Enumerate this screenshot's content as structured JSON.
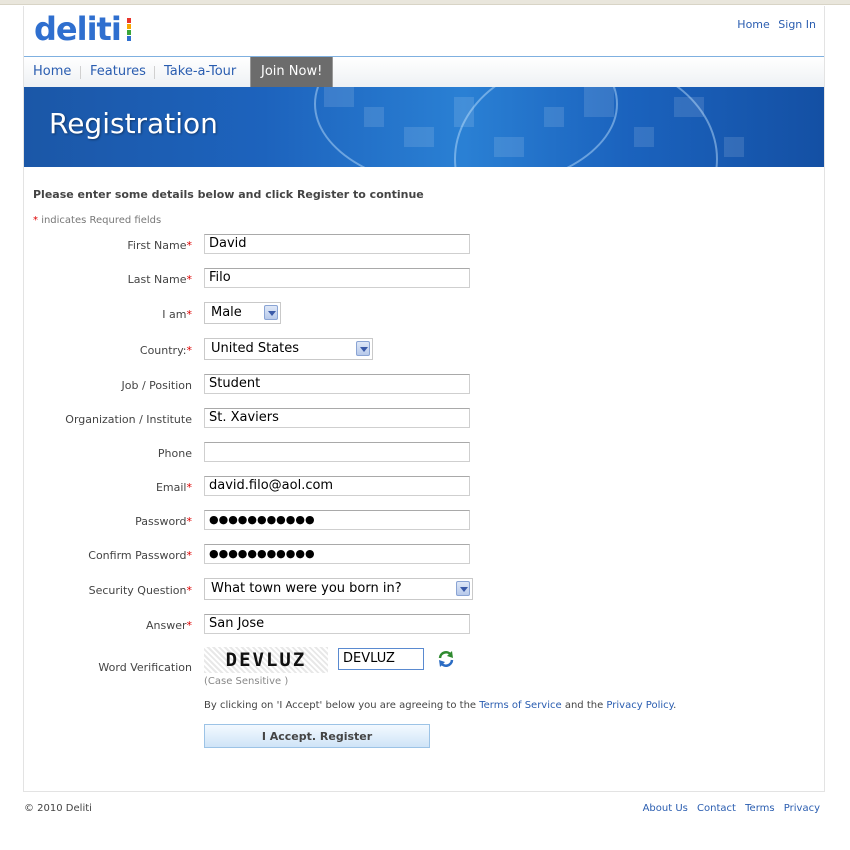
{
  "brand": {
    "logo_text": "deliti",
    "logo_colors": [
      "#e8352b",
      "#f7a600",
      "#3aa63a",
      "#2f6fcf"
    ]
  },
  "top_links": {
    "home": "Home",
    "sign_in": "Sign In"
  },
  "nav": {
    "home": "Home",
    "features": "Features",
    "tour": "Take-a-Tour",
    "join": "Join Now!"
  },
  "banner": {
    "title": "Registration"
  },
  "form": {
    "intro": "Please enter some details below and click Register to continue",
    "required_note_star": "*",
    "required_note": "indicates Requred fields",
    "first_name": {
      "label": "First Name",
      "value": "David"
    },
    "last_name": {
      "label": "Last Name",
      "value": "Filo"
    },
    "gender": {
      "label": "I am",
      "value": "Male"
    },
    "country": {
      "label": "Country:",
      "value": "United States"
    },
    "job": {
      "label": "Job / Position",
      "value": "Student"
    },
    "organization": {
      "label": "Organization / Institute",
      "value": "St. Xaviers"
    },
    "phone": {
      "label": "Phone",
      "value": ""
    },
    "email": {
      "label": "Email",
      "value": "david.filo@aol.com"
    },
    "password": {
      "label": "Password",
      "value": "●●●●●●●●●●●"
    },
    "confirm_password": {
      "label": "Confirm Password",
      "value": "●●●●●●●●●●●"
    },
    "security_question": {
      "label": "Security Question",
      "value": "What town were you born in?"
    },
    "answer": {
      "label": "Answer",
      "value": "San Jose"
    },
    "word_verification": {
      "label": "Word Verification",
      "captcha_text": "DEVLUZ",
      "value": "DEVLUZ",
      "case_note": "(Case Sensitive )"
    },
    "agreement": {
      "prefix": "By clicking on 'I Accept' below you are agreeing to the ",
      "terms": "Terms of Service",
      "middle": " and the ",
      "privacy": "Privacy Policy",
      "suffix": "."
    },
    "submit_label": "I Accept. Register"
  },
  "footer": {
    "copyright": "© 2010 Deliti",
    "links": [
      "About Us",
      "Contact",
      "Terms",
      "Privacy"
    ]
  }
}
